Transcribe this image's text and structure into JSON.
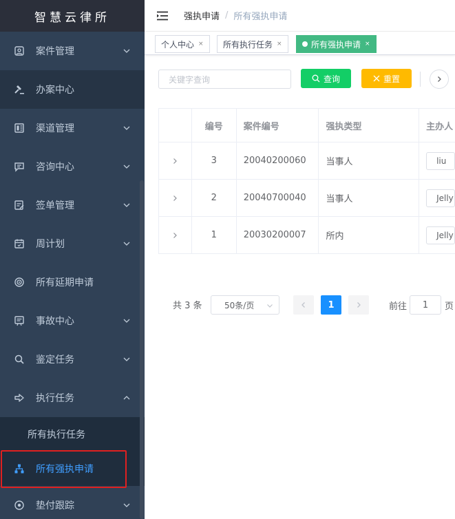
{
  "brand": "智慧云律所",
  "sidebar": {
    "items": [
      {
        "label": "案件管理",
        "has_arrow": true
      },
      {
        "label": "办案中心",
        "has_arrow": false
      },
      {
        "label": "渠道管理",
        "has_arrow": true
      },
      {
        "label": "咨询中心",
        "has_arrow": true
      },
      {
        "label": "签单管理",
        "has_arrow": true
      },
      {
        "label": "周计划",
        "has_arrow": true
      },
      {
        "label": "所有延期申请",
        "has_arrow": false
      },
      {
        "label": "事故中心",
        "has_arrow": true
      },
      {
        "label": "鉴定任务",
        "has_arrow": true
      },
      {
        "label": "执行任务",
        "has_arrow": true,
        "expanded": true
      },
      {
        "label": "垫付跟踪",
        "has_arrow": true
      }
    ],
    "sub_items": [
      {
        "label": "所有执行任务"
      },
      {
        "label": "所有强执申请",
        "selected": true
      }
    ]
  },
  "header": {
    "crumb_parent": "强执申请",
    "crumb_separator": "/",
    "crumb_current": "所有强执申请"
  },
  "tags": [
    {
      "label": "个人中心",
      "active": false
    },
    {
      "label": "所有执行任务",
      "active": false
    },
    {
      "label": "所有强执申请",
      "active": true
    }
  ],
  "tag_close": "×",
  "search": {
    "placeholder": "关键字查询",
    "query_label": "查询",
    "reset_label": "重置"
  },
  "table": {
    "headers": [
      "",
      "编号",
      "案件编号",
      "强执类型",
      "主办人"
    ],
    "rows": [
      {
        "id": "3",
        "case_no": "20040200060",
        "type": "当事人",
        "owner": "liu"
      },
      {
        "id": "2",
        "case_no": "20040700040",
        "type": "当事人",
        "owner": "Jelly"
      },
      {
        "id": "1",
        "case_no": "20030200007",
        "type": "所内",
        "owner": "Jelly"
      }
    ]
  },
  "pagination": {
    "total": "共 3 条",
    "page_size": "50条/页",
    "current_page": "1",
    "goto_label": "前往",
    "goto_value": "1",
    "page_unit": "页"
  },
  "colors": {
    "sidebar_bg": "#304156",
    "accent": "#409eff",
    "query": "#13ce66",
    "reset": "#ffba00",
    "tag_active": "#42b983",
    "highlight": "#e02020"
  }
}
